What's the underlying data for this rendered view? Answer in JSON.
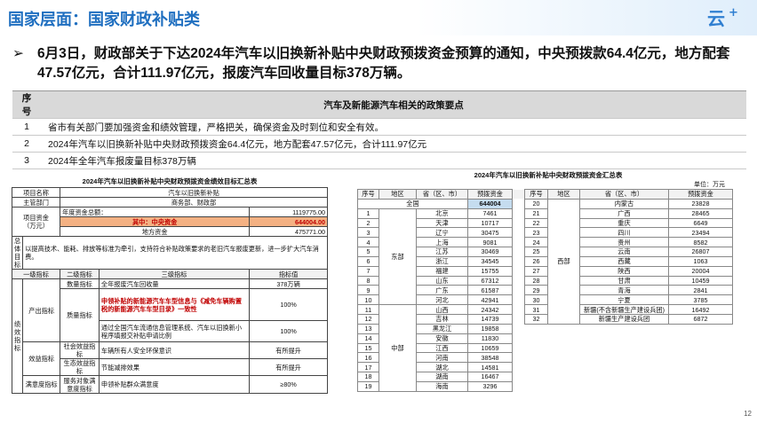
{
  "page": {
    "title": "国家层面：国家财政补贴类",
    "headline": "6月3日，财政部关于下达2024年汽车以旧换新补贴中央财政预拨资金预算的通知，中央预拨款64.4亿元，地方配套47.57亿元，合计111.97亿元，报废汽车回收量目标378万辆。",
    "bullet": "➢",
    "page_number": "12",
    "logo_text": "云+"
  },
  "policy_table": {
    "col_num": "序号",
    "col_content": "汽车及新能源汽车相关的政策要点",
    "rows": [
      {
        "num": "1",
        "text": "省市有关部门要加强资金和绩效管理，严格把关，确保资金及时到位和安全有效。"
      },
      {
        "num": "2",
        "text": "2024年汽车以旧换新补贴中央财政预拨资金64.4亿元，地方配套47.57亿元，合计111.97亿元"
      },
      {
        "num": "3",
        "text": "2024年全年汽车报废量目标378万辆"
      }
    ]
  },
  "perf_table": {
    "caption": "2024年汽车以旧换新补贴中央财政预拨资金绩效目标汇总表",
    "r1": [
      "项目名称",
      "汽车以旧换新补贴"
    ],
    "r2": [
      "主管部门",
      "商务部、财政部"
    ],
    "budget_label": "项目资金\n（万元）",
    "budget_rows": [
      {
        "label": "年度资金总额：",
        "value": "1119775.00"
      },
      {
        "label": "其中：中央资金",
        "value": "644004.00"
      },
      {
        "label": "地方资金",
        "value": "475771.00"
      }
    ],
    "goal_label": "总体目标",
    "goal_text": "以提高技术、能耗、排放等标准为牵引，支持符合补贴政策要求的老旧汽车报废更新，进一步扩大汽车消费。",
    "header": [
      "一级指标",
      "二级指标",
      "三级指标",
      "指标值"
    ],
    "perf_label": "绩效指标",
    "output_label": "产出指标",
    "qty_label": "数量指标",
    "quality_label": "质量指标",
    "benefit_label": "效益指标",
    "social_label": "社会效益指标",
    "eco_label": "生态效益指标",
    "satis_label": "满意度指标",
    "satis_sub": "服务对象满意度指标",
    "rows": [
      {
        "ind": "全年报废汽车回收量",
        "val": "378万辆"
      },
      {
        "ind": "申领补贴的新能源汽车车型信息与《减免车辆购置税的新能源汽车车型目录》一致性",
        "val": "100%"
      },
      {
        "ind": "通过全国汽车流通信息管理系统、汽车以旧换新小程序填报交补贴申请比例",
        "val": "100%"
      },
      {
        "ind": "车辆所有人安全环保意识",
        "val": "有所提升"
      },
      {
        "ind": "节能减排效果",
        "val": "有所提升"
      },
      {
        "ind": "申领补贴群众满意度",
        "val": "≥80%"
      }
    ]
  },
  "alloc_table": {
    "caption": "2024年汽车以旧换新补贴中央财政预拨资金汇总表",
    "unit": "单位：万元",
    "header": [
      "序号",
      "地区",
      "省（区、市）",
      "预拨资金",
      "序号",
      "地区",
      "省（区、市）",
      "预拨资金"
    ],
    "total_label": "全国",
    "total_value": "644004",
    "east_label": "东部",
    "central_label": "中部",
    "west_label": "西部",
    "left_rows": [
      {
        "n": "1",
        "p": "北京",
        "v": "7461"
      },
      {
        "n": "2",
        "p": "天津",
        "v": "10717"
      },
      {
        "n": "3",
        "p": "辽宁",
        "v": "30475"
      },
      {
        "n": "4",
        "p": "上海",
        "v": "9081"
      },
      {
        "n": "5",
        "p": "江苏",
        "v": "30469"
      },
      {
        "n": "6",
        "p": "浙江",
        "v": "34545"
      },
      {
        "n": "7",
        "p": "福建",
        "v": "15755"
      },
      {
        "n": "8",
        "p": "山东",
        "v": "67312"
      },
      {
        "n": "9",
        "p": "广东",
        "v": "61587"
      },
      {
        "n": "10",
        "p": "河北",
        "v": "42941"
      },
      {
        "n": "11",
        "p": "山西",
        "v": "24342"
      },
      {
        "n": "12",
        "p": "吉林",
        "v": "14739"
      },
      {
        "n": "13",
        "p": "黑龙江",
        "v": "19858"
      },
      {
        "n": "14",
        "p": "安徽",
        "v": "11830"
      },
      {
        "n": "15",
        "p": "江西",
        "v": "10659"
      },
      {
        "n": "16",
        "p": "河南",
        "v": "38548"
      },
      {
        "n": "17",
        "p": "湖北",
        "v": "14581"
      },
      {
        "n": "18",
        "p": "湖南",
        "v": "16467"
      },
      {
        "n": "19",
        "p": "海南",
        "v": "3296"
      }
    ],
    "right_rows": [
      {
        "n": "20",
        "p": "内蒙古",
        "v": "23828"
      },
      {
        "n": "21",
        "p": "广西",
        "v": "28465"
      },
      {
        "n": "22",
        "p": "重庆",
        "v": "6649"
      },
      {
        "n": "23",
        "p": "四川",
        "v": "23494"
      },
      {
        "n": "24",
        "p": "贵州",
        "v": "8582"
      },
      {
        "n": "25",
        "p": "云南",
        "v": "26807"
      },
      {
        "n": "26",
        "p": "西藏",
        "v": "1063"
      },
      {
        "n": "27",
        "p": "陕西",
        "v": "20004"
      },
      {
        "n": "28",
        "p": "甘肃",
        "v": "10459"
      },
      {
        "n": "29",
        "p": "青海",
        "v": "2841"
      },
      {
        "n": "30",
        "p": "宁夏",
        "v": "3785"
      },
      {
        "n": "31",
        "p": "新疆(不含新疆生产建设兵团)",
        "v": "16492"
      },
      {
        "n": "32",
        "p": "新疆生产建设兵团",
        "v": "6872"
      }
    ]
  }
}
